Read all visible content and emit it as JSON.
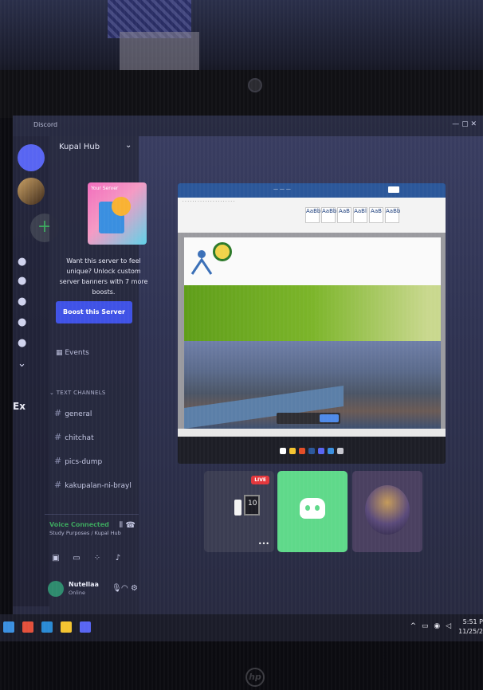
{
  "window": {
    "title": "Discord"
  },
  "server": {
    "name": "Kupal Hub"
  },
  "banner_card": {
    "label": "Your Server"
  },
  "promo": {
    "text": "Want this server to feel unique? Unlock custom server banners with 7 more boosts.",
    "boost_button": "Boost this Server"
  },
  "events_label": "Events",
  "text_channels": {
    "category": "TEXT CHANNELS",
    "items": [
      {
        "name": "general"
      },
      {
        "name": "chitchat"
      },
      {
        "name": "pics-dump"
      },
      {
        "name": "kakupalan-ni-brayl"
      }
    ]
  },
  "voice": {
    "status": "Voice Connected",
    "channel": "Study Purposes / Kupal Hub"
  },
  "user": {
    "name": "Nutellaa",
    "status": "Online"
  },
  "left_edge_labels": [
    "Ex"
  ],
  "stream": {
    "live_badge": "LIVE",
    "monitor_text": "10",
    "ribbon_styles": [
      "AaBb",
      "AaBb",
      "AaB",
      "AaBl",
      "AaB",
      "AaBb"
    ]
  },
  "taskbar": {
    "time": "5:51 P",
    "date": "11/25/2"
  },
  "brand": "hp"
}
